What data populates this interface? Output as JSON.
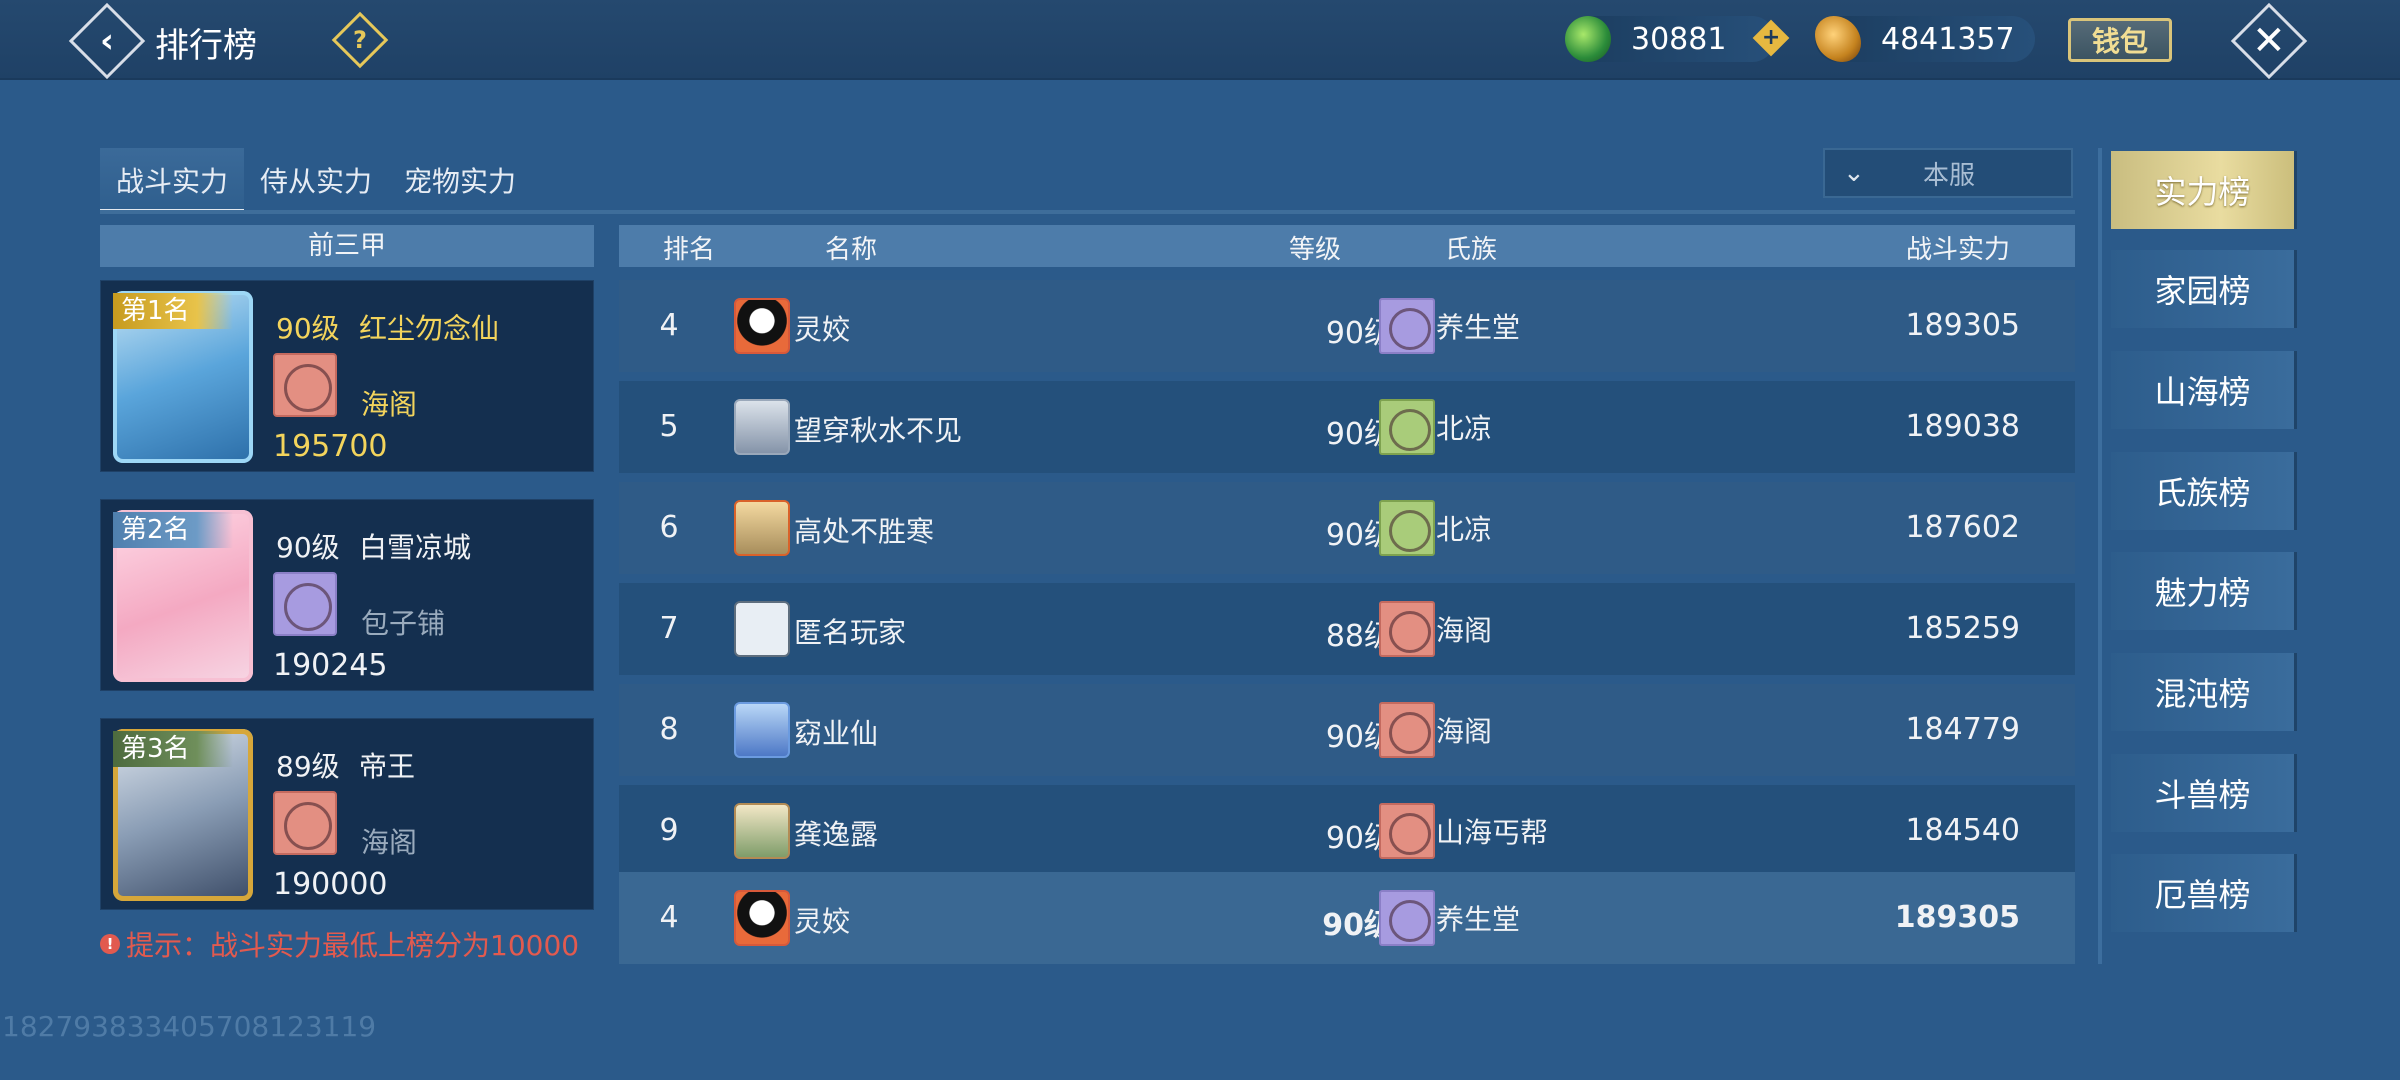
{
  "header": {
    "back_icon": "‹",
    "title": "排行榜",
    "help_icon": "?",
    "jade_amount": "30881",
    "gold_amount": "4841357",
    "plus_icon": "+",
    "wallet_label": "钱包",
    "close_icon": "✕"
  },
  "tabs": [
    "战斗实力",
    "侍从实力",
    "宠物实力"
  ],
  "server_filter": {
    "chevron": "⌄",
    "label": "本服"
  },
  "top3": {
    "header": "前三甲",
    "cards": [
      {
        "rank_label": "第1名",
        "level": "90级",
        "name": "红尘勿念仙",
        "clan": "海阁",
        "power": "195700"
      },
      {
        "rank_label": "第2名",
        "level": "90级",
        "name": "白雪凉城",
        "clan": "包子铺",
        "power": "190245"
      },
      {
        "rank_label": "第3名",
        "level": "89级",
        "name": "帝王",
        "clan": "海阁",
        "power": "190000"
      }
    ]
  },
  "tip": {
    "icon": "!",
    "text": "提示：战斗实力最低上榜分为10000"
  },
  "table": {
    "headers": {
      "rank": "排名",
      "name": "名称",
      "level": "等级",
      "clan": "氏族",
      "power": "战斗实力"
    },
    "rows": [
      {
        "rank": "4",
        "name": "灵姣",
        "level": "90级",
        "clan": "养生堂",
        "power": "189305"
      },
      {
        "rank": "5",
        "name": "望穿秋水不见",
        "level": "90级",
        "clan": "北凉",
        "power": "189038"
      },
      {
        "rank": "6",
        "name": "高处不胜寒",
        "level": "90级",
        "clan": "北凉",
        "power": "187602"
      },
      {
        "rank": "7",
        "name": "匿名玩家",
        "level": "88级",
        "clan": "海阁",
        "power": "185259"
      },
      {
        "rank": "8",
        "name": "窈业仙",
        "level": "90级",
        "clan": "海阁",
        "power": "184779"
      },
      {
        "rank": "9",
        "name": "龚逸露",
        "level": "90级",
        "clan": "山海丐帮",
        "power": "184540"
      }
    ],
    "my_row": {
      "rank": "4",
      "name": "灵姣",
      "level": "90级",
      "clan": "养生堂",
      "power": "189305"
    }
  },
  "side_tabs": [
    "实力榜",
    "家园榜",
    "山海榜",
    "氏族榜",
    "魅力榜",
    "混沌榜",
    "斗兽榜",
    "厄兽榜"
  ],
  "uid": "182793833405708123119"
}
